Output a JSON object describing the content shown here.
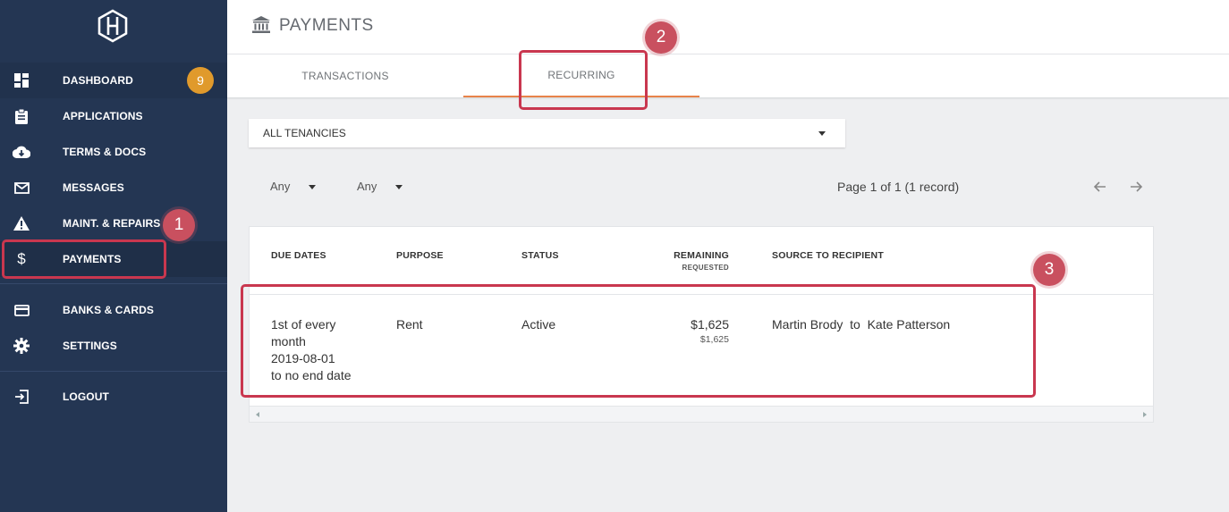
{
  "sidebar": {
    "items": [
      {
        "label": "DASHBOARD",
        "icon": "dashboard-icon",
        "badge": "9"
      },
      {
        "label": "APPLICATIONS",
        "icon": "clipboard-icon"
      },
      {
        "label": "TERMS & DOCS",
        "icon": "cloud-download-icon"
      },
      {
        "label": "MESSAGES",
        "icon": "envelope-icon"
      },
      {
        "label": "MAINT. & REPAIRS",
        "icon": "warning-icon"
      },
      {
        "label": "PAYMENTS",
        "icon": "dollar-icon",
        "active": true
      },
      {
        "label": "BANKS & CARDS",
        "icon": "credit-card-icon"
      },
      {
        "label": "SETTINGS",
        "icon": "gear-icon"
      },
      {
        "label": "LOGOUT",
        "icon": "logout-icon"
      }
    ]
  },
  "header": {
    "title": "PAYMENTS",
    "icon": "bank-icon"
  },
  "tabs": [
    {
      "label": "TRANSACTIONS"
    },
    {
      "label": "RECURRING",
      "active": true
    }
  ],
  "filters": {
    "tenancy": "ALL TENANCIES",
    "filter1": "Any",
    "filter2": "Any",
    "pager": "Page 1 of 1 (1 record)"
  },
  "table": {
    "headers": {
      "due_dates": "DUE DATES",
      "purpose": "PURPOSE",
      "status": "STATUS",
      "remaining": "REMAINING",
      "requested": "REQUESTED",
      "source": "SOURCE  TO  RECIPIENT"
    },
    "rows": [
      {
        "due_line1": "1st of every",
        "due_line2": "month",
        "due_line3": "2019-08-01",
        "due_line4": "to no end date",
        "purpose": "Rent",
        "status": "Active",
        "remaining": "$1,625",
        "requested": "$1,625",
        "source": "Martin Brody  to  Kate Patterson"
      }
    ]
  },
  "annotations": {
    "m1": "1",
    "m2": "2",
    "m3": "3"
  },
  "colors": {
    "sidebar": "#243653",
    "accent": "#e8834a",
    "badge": "#e09a2c",
    "highlight": "#c9374f"
  }
}
